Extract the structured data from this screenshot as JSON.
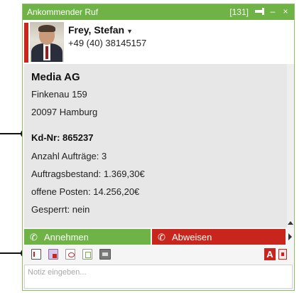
{
  "window": {
    "title": "Ankommender Ruf",
    "count": "[131]",
    "pin_glyph": "pin-icon",
    "minimize_glyph": "–",
    "close_glyph": "×"
  },
  "caller": {
    "name": "Frey, Stefan",
    "dropdown_glyph": "▼",
    "phone": "+49 (40) 38145157"
  },
  "customer": {
    "company": "Media AG",
    "street": "Finkenau 159",
    "city": "20097 Hamburg",
    "customer_number": "Kd-Nr: 865237",
    "order_count": "Anzahl Aufträge: 3",
    "order_volume": "Auftragsbestand: 1.369,30€",
    "open_items": "offene Posten: 14.256,20€",
    "blocked": "Gesperrt: nein"
  },
  "actions": {
    "accept_label": "Annehmen",
    "reject_label": "Abweisen",
    "accept_icon": "phone-accept-icon",
    "reject_icon": "phone-reject-icon"
  },
  "toolbar": {
    "tool_icons": [
      "document-icon",
      "mail-icon",
      "pdf-icon",
      "copy-icon",
      "image-icon"
    ],
    "text_icon_label": "A",
    "print_icon": "record-icon"
  },
  "note": {
    "placeholder": "Notiz eingeben..."
  },
  "colors": {
    "accent_green": "#6fb346",
    "accent_red": "#c8261c",
    "info_background": "#e7e7e7"
  }
}
